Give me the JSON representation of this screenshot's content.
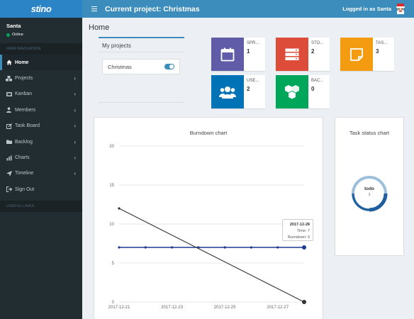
{
  "header": {
    "logo": "stino",
    "project_title": "Current project: Christmas",
    "logged_in": "Logged in as Santa"
  },
  "sidebar": {
    "user_name": "Santa",
    "user_status": "Online",
    "main_nav_header": "MAIN NAVIGATION",
    "items": [
      {
        "label": "Home",
        "icon": "home-icon",
        "active": true
      },
      {
        "label": "Projects",
        "icon": "cubes-icon"
      },
      {
        "label": "Kanban",
        "icon": "kanban-icon"
      },
      {
        "label": "Members",
        "icon": "users-icon"
      },
      {
        "label": "Task Board",
        "icon": "edit-icon"
      },
      {
        "label": "Backlog",
        "icon": "folder-icon"
      },
      {
        "label": "Charts",
        "icon": "charts-icon"
      },
      {
        "label": "Timeline",
        "icon": "send-icon"
      },
      {
        "label": "Sign Out",
        "icon": "sign-out-icon"
      }
    ],
    "useful_links_header": "USEFUL LINKS"
  },
  "page": {
    "title": "Home",
    "my_projects_title": "My projects",
    "projects": [
      {
        "name": "Christmas",
        "enabled": true
      }
    ]
  },
  "info_boxes": [
    {
      "label": "SPR...",
      "value": "1",
      "color": "#605ca8",
      "icon": "calendar-icon"
    },
    {
      "label": "STO...",
      "value": "2",
      "color": "#dd4b39",
      "icon": "server-icon"
    },
    {
      "label": "TAS...",
      "value": "3",
      "color": "#f39c12",
      "icon": "sticky-note-icon"
    },
    {
      "label": "USE...",
      "value": "2",
      "color": "#0073b7",
      "icon": "users-icon"
    },
    {
      "label": "BAC...",
      "value": "0",
      "color": "#00a65a",
      "icon": "cubes-icon"
    }
  ],
  "burndown": {
    "title": "Burndown chart",
    "tooltip": {
      "date": "2017-12-28",
      "time": "Time: 7",
      "burndown": "Burndown: 0"
    }
  },
  "task_status": {
    "title": "Task status chart",
    "center_label": "todo",
    "center_value": "1"
  },
  "chart_data": [
    {
      "type": "line",
      "title": "Burndown chart",
      "x": [
        "2017-12-21",
        "2017-12-22",
        "2017-12-23",
        "2017-12-24",
        "2017-12-25",
        "2017-12-26",
        "2017-12-27",
        "2017-12-28"
      ],
      "x_tick_labels": [
        "2017-12-21",
        "2017-12-23",
        "2017-12-25",
        "2017-12-27"
      ],
      "ylim": [
        0,
        20
      ],
      "y_ticks": [
        0,
        5,
        10,
        15,
        20
      ],
      "grid": true,
      "series": [
        {
          "name": "Time",
          "color": "#1f3a93",
          "values": [
            7,
            7,
            7,
            7,
            7,
            7,
            7,
            7
          ]
        },
        {
          "name": "Burndown",
          "color": "#333333",
          "values": [
            12,
            null,
            null,
            null,
            null,
            null,
            null,
            0
          ]
        }
      ]
    },
    {
      "type": "pie",
      "title": "Task status chart",
      "categories": [
        "todo"
      ],
      "values": [
        1
      ],
      "colors": [
        "#1f5f9e"
      ]
    }
  ]
}
